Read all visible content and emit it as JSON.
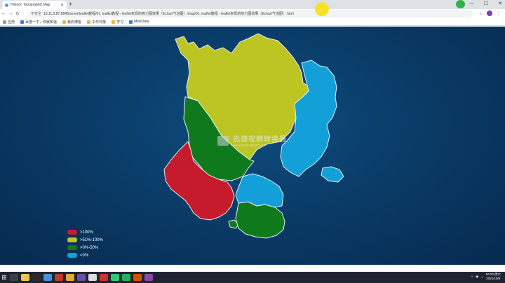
{
  "browser": {
    "tab_title": "Historic Topographic Map",
    "new_tab": "+",
    "window_controls": [
      "—",
      "☐",
      "✕"
    ],
    "insecure_label": "不安全",
    "url": "10.11.0.87:8848/sever/leaflet教程/01. leaflet教程 - leaflet实现的热力图效果（Echart气泡图）/map/01. leaflet教程 - leaflet实现的热力图效果（Echart气泡图）.html",
    "bookmarks": [
      "应用",
      "百度一下，你就知道",
      "我的博客",
      "工作日报",
      "学习",
      "MineData"
    ]
  },
  "map": {
    "watermark": {
      "main": "迅捷视频转换器",
      "sub": "www.xunjieshipin.com"
    },
    "colors": {
      "over_100": "#c51b2c",
      "p51_100": "#bcc521",
      "p0_50": "#0f7a1c",
      "below_0": "#13a0d8",
      "background": "#0a3c68"
    }
  },
  "legend": [
    {
      "label": ">100%",
      "color": "#c51b2c"
    },
    {
      "label": ">51%-100%",
      "color": "#bcc521"
    },
    {
      "label": ">0%-50%",
      "color": "#0f7a1c"
    },
    {
      "label": "<0%",
      "color": "#13a0d8"
    }
  ],
  "taskbar": {
    "time": "10:20 周六",
    "date": "2021/10/9"
  }
}
